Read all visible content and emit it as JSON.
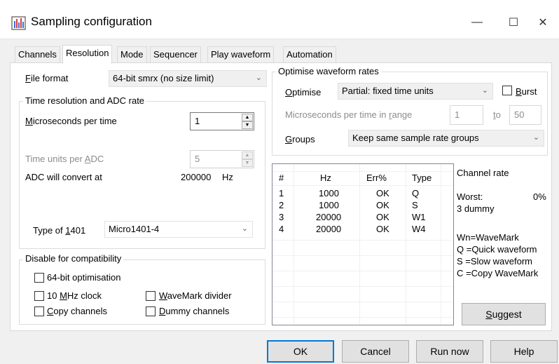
{
  "window": {
    "title": "Sampling configuration",
    "minimize": "—",
    "maximize": "☐",
    "close": "✕"
  },
  "tabs": [
    "Channels",
    "Resolution",
    "Mode",
    "Sequencer",
    "Play waveform",
    "Automation"
  ],
  "active_tab": "Resolution",
  "file_format": {
    "label_pre": "",
    "label_ul": "F",
    "label_post": "ile format",
    "value": "64-bit smrx (no size limit)"
  },
  "time_resolution": {
    "group_label": "Time resolution and ADC rate",
    "us_label_ul": "M",
    "us_label_post": "icroseconds per time",
    "us_value": "1",
    "tu_label_pre": "Time units per ",
    "tu_label_ul": "A",
    "tu_label_post": "DC",
    "tu_value": "5",
    "adc_label": "ADC will convert at",
    "adc_value": "200000",
    "adc_unit": "Hz"
  },
  "type_1401": {
    "label_pre": "Type of ",
    "label_ul": "1",
    "label_post": "401",
    "value": "Micro1401-4"
  },
  "compatibility": {
    "group_label": "Disable for compatibility",
    "opt64": "64-bit optimisation",
    "mhz_pre": "10 ",
    "mhz_ul": "M",
    "mhz_post": "Hz clock",
    "wavemark_ul": "W",
    "wavemark_post": "aveMark divider",
    "copy_ul": "C",
    "copy_post": "opy channels",
    "dummy_ul": "D",
    "dummy_post": "ummy channels"
  },
  "optimise": {
    "group_label": "Optimise waveform rates",
    "label_ul": "O",
    "label_post": "ptimise",
    "value": "Partial: fixed time units",
    "burst_ul": "B",
    "burst_post": "urst",
    "range_pre": "Microseconds per time in ",
    "range_ul": "r",
    "range_post": "ange",
    "range_from": "1",
    "to_ul": "t",
    "to_post": "o",
    "range_to": "50",
    "groups_ul": "G",
    "groups_post": "roups",
    "groups_value": "Keep same sample rate groups"
  },
  "rate_table": {
    "headers": [
      "#",
      "Hz",
      "Err%",
      "Type"
    ],
    "rows": [
      [
        "1",
        "1000",
        "OK",
        "Q"
      ],
      [
        "2",
        "1000",
        "OK",
        "S"
      ],
      [
        "3",
        "20000",
        "OK",
        "W1"
      ],
      [
        "4",
        "20000",
        "OK",
        "W4"
      ]
    ]
  },
  "channel_rate": {
    "title": "Channel rate",
    "worst_label": "Worst:",
    "worst_value": "0%",
    "worst_note": "3 dummy",
    "legend": [
      "Wn=WaveMark",
      "Q =Quick waveform",
      "S =Slow waveform",
      "C =Copy WaveMark"
    ],
    "suggest_ul": "S",
    "suggest_post": "uggest"
  },
  "buttons": {
    "ok": "OK",
    "cancel": "Cancel",
    "run_now": "Run now",
    "help": "Help"
  },
  "colors": {
    "accent": "#0078d7"
  }
}
